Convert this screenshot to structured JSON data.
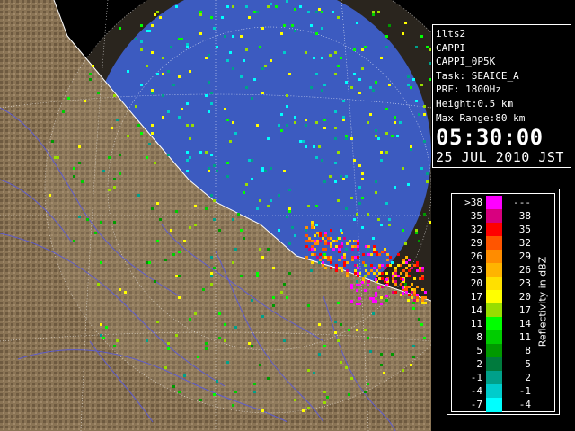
{
  "info": {
    "lines": [
      "ilts2",
      "CAPPI",
      "CAPPI_0P5K",
      "Task: SEAICE_A",
      "PRF: 1800Hz",
      "Height:0.5 km",
      "Max Range:80 km"
    ],
    "time": "05:30:00",
    "date": "25 JUL 2010 JST"
  },
  "legend": {
    "title": "Reflectivity in dBZ",
    "rows": [
      {
        "lo": ">38",
        "hi": "---",
        "color": "#ff00ff"
      },
      {
        "lo": "35",
        "hi": "38",
        "color": "#d8007f"
      },
      {
        "lo": "32",
        "hi": "35",
        "color": "#ff0000"
      },
      {
        "lo": "29",
        "hi": "32",
        "color": "#ff5500"
      },
      {
        "lo": "26",
        "hi": "29",
        "color": "#ff8c00"
      },
      {
        "lo": "23",
        "hi": "26",
        "color": "#ffb400"
      },
      {
        "lo": "20",
        "hi": "23",
        "color": "#ffe000"
      },
      {
        "lo": "17",
        "hi": "20",
        "color": "#ffff00"
      },
      {
        "lo": "14",
        "hi": "17",
        "color": "#99dd00"
      },
      {
        "lo": "11",
        "hi": "14",
        "color": "#00ff00"
      },
      {
        "lo": "8",
        "hi": "11",
        "color": "#00cc00"
      },
      {
        "lo": "5",
        "hi": "8",
        "color": "#009900"
      },
      {
        "lo": "2",
        "hi": "5",
        "color": "#007a3d"
      },
      {
        "lo": "-1",
        "hi": "2",
        "color": "#00a08a"
      },
      {
        "lo": "-4",
        "hi": "-1",
        "color": "#00cccc"
      },
      {
        "lo": "-7",
        "hi": "-4",
        "color": "#00ffff"
      }
    ]
  },
  "map": {
    "sea_color": "#1848d8",
    "outside_color": "#000000",
    "land_color": "#8a7455",
    "river_color": "#5a5ad8",
    "grid_color": "#ffffff"
  }
}
